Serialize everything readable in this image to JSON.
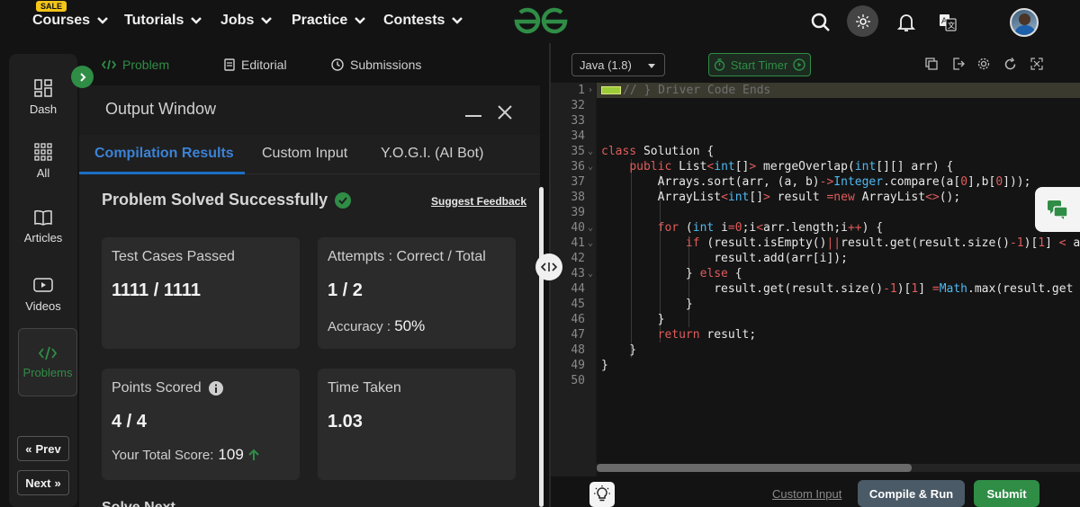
{
  "nav": {
    "sale_badge": "SALE",
    "items": [
      "Courses",
      "Tutorials",
      "Jobs",
      "Practice",
      "Contests"
    ]
  },
  "sidebar": {
    "items": [
      {
        "label": "Dash",
        "icon": "dashboard-icon"
      },
      {
        "label": "All",
        "icon": "grid-icon"
      },
      {
        "label": "Articles",
        "icon": "book-icon"
      },
      {
        "label": "Videos",
        "icon": "video-icon"
      },
      {
        "label": "Problems",
        "icon": "code-icon"
      }
    ],
    "prev_label": "Prev",
    "next_label": "Next"
  },
  "problem_tabs": [
    "Problem",
    "Editorial",
    "Submissions"
  ],
  "output": {
    "title": "Output Window",
    "tabs": [
      "Compilation Results",
      "Custom Input",
      "Y.O.G.I. (AI Bot)"
    ],
    "status": "Problem Solved Successfully",
    "feedback_link": "Suggest Feedback",
    "cards": {
      "tests": {
        "label": "Test Cases Passed",
        "value": "1111 / 1111"
      },
      "attempts": {
        "label": "Attempts : Correct / Total",
        "value": "1 / 2",
        "sub_label": "Accuracy :",
        "sub_value": "50%"
      },
      "points": {
        "label": "Points Scored",
        "value": "4 / 4",
        "sub_label": "Your Total Score:",
        "sub_value": "109"
      },
      "time": {
        "label": "Time Taken",
        "value": "1.03"
      }
    },
    "peek_text": "Solve Next"
  },
  "editor": {
    "language": "Java (1.8)",
    "timer_label": "Start Timer",
    "custom_input_link": "Custom Input",
    "compile_label": "Compile & Run",
    "submit_label": "Submit"
  },
  "colors": {
    "brand_green": "#2f8d46",
    "accent_blue": "#1b6fc4"
  }
}
